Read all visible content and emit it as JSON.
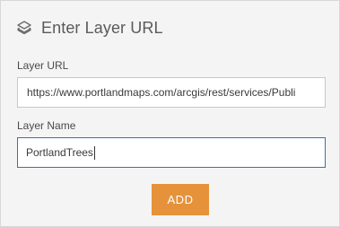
{
  "header": {
    "title": "Enter Layer URL",
    "icon": "layers-icon"
  },
  "form": {
    "url_label": "Layer URL",
    "url_value": "https://www.portlandmaps.com/arcgis/rest/services/Publi",
    "name_label": "Layer Name",
    "name_value": "PortlandTrees"
  },
  "actions": {
    "add_label": "ADD"
  },
  "colors": {
    "panel_bg": "#f4f4f4",
    "accent": "#e5923a",
    "focus_border": "#3b6fb6"
  }
}
